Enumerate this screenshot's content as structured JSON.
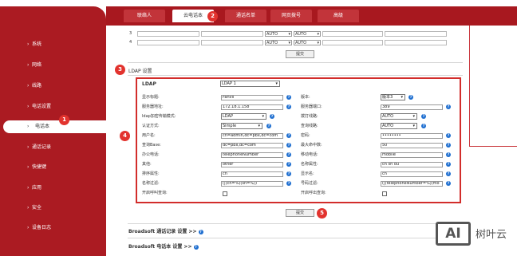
{
  "sidebar": {
    "items": [
      {
        "label": "系统"
      },
      {
        "label": "网络"
      },
      {
        "label": "线路"
      },
      {
        "label": "电话设置"
      },
      {
        "label": "电话本"
      },
      {
        "label": "通话记录"
      },
      {
        "label": "快捷键"
      },
      {
        "label": "应用"
      },
      {
        "label": "安全"
      },
      {
        "label": "设备日志"
      }
    ]
  },
  "tabs": [
    {
      "label": "联络人"
    },
    {
      "label": "云电话本"
    },
    {
      "label": "通话名单"
    },
    {
      "label": "网页拨号"
    },
    {
      "label": "高级"
    }
  ],
  "markers": [
    "1",
    "2",
    "3",
    "4",
    "5"
  ],
  "top_table": {
    "rows": [
      {
        "num": "3",
        "sel1": "AUTO",
        "sel2": "AUTO"
      },
      {
        "num": "4",
        "sel1": "AUTO",
        "sel2": "AUTO"
      }
    ],
    "submit_label": "提交"
  },
  "ldap_section": {
    "title": "LDAP 设置",
    "header_label": "LDAP",
    "header_select": "LDAP 1",
    "fields": {
      "display_title": {
        "label": "显示标题:",
        "value": "Fanvil"
      },
      "version": {
        "label": "版本:",
        "value": "版本3"
      },
      "server_address": {
        "label": "服务器地址:",
        "value": "172.18.1.158"
      },
      "server_port": {
        "label": "服务器端口:",
        "value": "389"
      },
      "encryption": {
        "label": "ldap加密传输模式:",
        "value": "LDAP"
      },
      "dial_line": {
        "label": "拨打线路:",
        "value": "AUTO"
      },
      "auth_method": {
        "label": "认证方式:",
        "value": "Simple"
      },
      "search_line": {
        "label": "查询线路:",
        "value": "AUTO"
      },
      "username": {
        "label": "用户名:",
        "value": "cn=admin,dc=pbx,dc=com"
      },
      "password": {
        "label": "密码:",
        "value": "••••••••"
      },
      "search_base": {
        "label": "查询Base:",
        "value": "dc=pbx,dc=com"
      },
      "max_hits": {
        "label": "最大命中数:",
        "value": "50"
      },
      "office_phone": {
        "label": "办公电话:",
        "value": "telephoneNumber"
      },
      "mobile_phone": {
        "label": "移动电话:",
        "value": "mobile"
      },
      "other": {
        "label": "其他:",
        "value": "other"
      },
      "name_attr": {
        "label": "名称属性:",
        "value": "cn sn ou"
      },
      "sort_attr": {
        "label": "排序属性:",
        "value": "cn"
      },
      "display_name": {
        "label": "显示名:",
        "value": "cn"
      },
      "name_filter": {
        "label": "名称过滤:",
        "value": "(|(cn=%)(sn=%))"
      },
      "number_filter": {
        "label": "号码过滤:",
        "value": "(|(telephoneNumber=%)(mo"
      },
      "incoming_lookup": {
        "label": "开启呼叫查询:"
      },
      "outgoing_lookup": {
        "label": "开启呼出查询:"
      }
    },
    "submit_label": "提交"
  },
  "broadsoft": {
    "call_log_link": "Broadsoft 通话记录 设置 >>",
    "phonebook_link": "Broadsoft 电话本 设置 >>"
  },
  "watermark": {
    "mark": "AI",
    "text": "树叶云"
  },
  "colors": {
    "brand_red": "#ab1b22",
    "highlight_red": "#d22d2b",
    "help_blue": "#1f6fd0"
  }
}
